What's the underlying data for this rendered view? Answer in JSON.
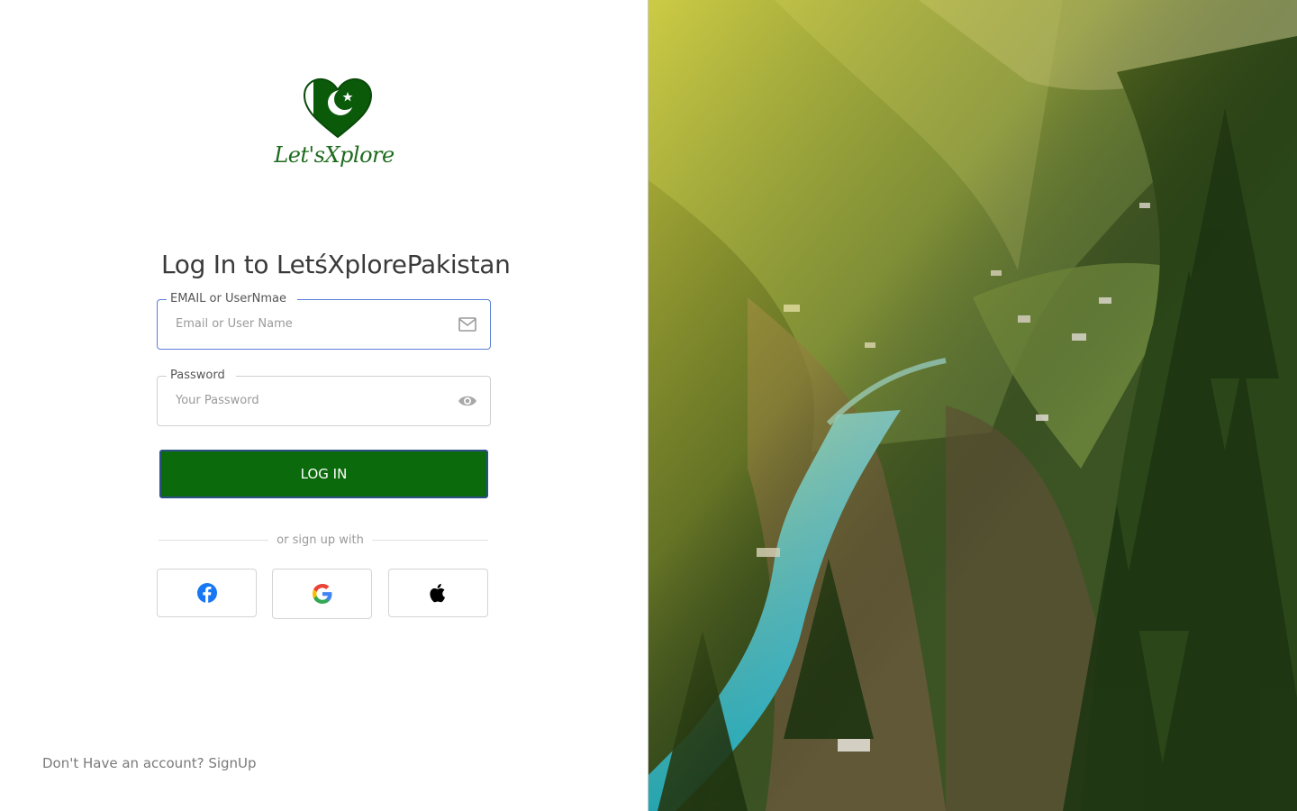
{
  "brand": {
    "logo_text": "Let'sXplore",
    "colors": {
      "primary_green": "#0b6a0b",
      "focus_border": "#5b7fd6",
      "logo_green": "#1e6b1e"
    }
  },
  "login": {
    "title": "Log In to LetśXplorePakistan",
    "email_field": {
      "label": "EMAIL or UserNmae",
      "placeholder": "Email or User Name",
      "value": "",
      "icon": "mail-icon"
    },
    "password_field": {
      "label": "Password",
      "placeholder": "Your Password",
      "value": "",
      "icon": "eye-icon"
    },
    "login_button": "LOG IN",
    "divider_text": "or sign up with",
    "social": [
      {
        "name": "facebook",
        "icon": "facebook-icon",
        "color": "#1877f2"
      },
      {
        "name": "google",
        "icon": "google-icon"
      },
      {
        "name": "apple",
        "icon": "apple-icon",
        "color": "#000000"
      }
    ],
    "signup_prompt": "Don't Have an account?",
    "signup_link": "SignUp"
  },
  "hero": {
    "icon": "landscape-photo"
  }
}
